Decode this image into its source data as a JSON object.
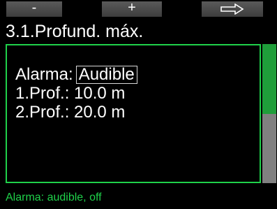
{
  "softkeys": {
    "minus_label": "-",
    "plus_label": "+",
    "next_icon": "arrow-right-icon"
  },
  "screen": {
    "title": "3.1.Profund. máx."
  },
  "settings": [
    {
      "label": "Alarma:",
      "value": "Audible",
      "selected": true
    },
    {
      "label": "1.Prof.:",
      "value": "10.0 m",
      "selected": false
    },
    {
      "label": "2.Prof.:",
      "value": "20.0 m",
      "selected": false
    }
  ],
  "status": {
    "text": "Alarma: audible, off"
  },
  "scroll": {
    "position_fraction": 0.0,
    "visible_fraction": 0.5
  },
  "colors": {
    "background": "#000000",
    "accent_green": "#1fd14a",
    "scroll_thumb": "#1f9e3a",
    "scroll_track": "#808080",
    "softkey_bg": "#4d4d4d",
    "text": "#ffffff"
  }
}
